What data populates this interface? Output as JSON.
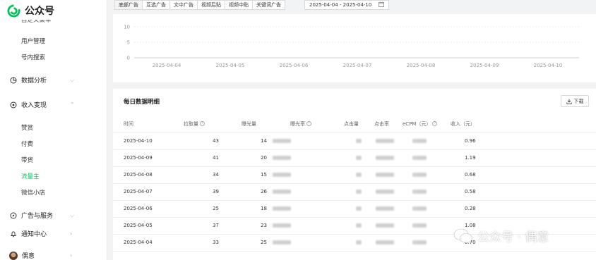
{
  "app": {
    "title": "公众号"
  },
  "sidebar": {
    "cut_item": "自定义菜单",
    "items_top": [
      {
        "label": "用户管理"
      },
      {
        "label": "号内搜索"
      }
    ],
    "groups": {
      "analytics": {
        "label": "数据分析",
        "icon": "chart-icon"
      },
      "monetize": {
        "label": "收入变现",
        "icon": "coin-icon"
      },
      "ads": {
        "label": "广告与服务",
        "icon": "compass-icon"
      },
      "notify": {
        "label": "通知中心",
        "icon": "bell-icon"
      },
      "account": {
        "label": "偶意",
        "icon": "avatar"
      }
    },
    "monetize_items": [
      {
        "label": "赞赏"
      },
      {
        "label": "付费"
      },
      {
        "label": "带货"
      },
      {
        "label": "流量主",
        "active": true
      },
      {
        "label": "微信小店"
      }
    ],
    "accent": "#07c160"
  },
  "filters": {
    "tabs": [
      {
        "label": "底部广告",
        "active": true
      },
      {
        "label": "互选广告"
      },
      {
        "label": "文中广告"
      },
      {
        "label": "视频后贴"
      },
      {
        "label": "视频中贴"
      },
      {
        "label": "关键词广告"
      }
    ],
    "date_range": "2025-04-04 - 2025-04-10"
  },
  "chart_data": {
    "type": "line",
    "x": [
      "2025-04-04",
      "2025-04-05",
      "2025-04-06",
      "2025-04-07",
      "2025-04-08",
      "2025-04-09",
      "2025-04-10"
    ],
    "yticks": [
      "10",
      "5",
      "0"
    ],
    "ylim": [
      0,
      10
    ],
    "grid": true
  },
  "table": {
    "title": "每日数据明细",
    "download_label": "下载",
    "columns": [
      "时间",
      "拉取量",
      "曝光量",
      "曝光率",
      "点击量",
      "点击率",
      "eCPM（元）",
      "收入（元）"
    ],
    "rows": [
      {
        "date": "2025-04-10",
        "pull": "43",
        "exposure": "14",
        "income": "0.96"
      },
      {
        "date": "2025-04-09",
        "pull": "41",
        "exposure": "20",
        "income": "1.19"
      },
      {
        "date": "2025-04-08",
        "pull": "34",
        "exposure": "15",
        "income": "0.68"
      },
      {
        "date": "2025-04-07",
        "pull": "39",
        "exposure": "26",
        "income": "0.58"
      },
      {
        "date": "2025-04-06",
        "pull": "25",
        "exposure": "18",
        "income": "0.28"
      },
      {
        "date": "2025-04-05",
        "pull": "37",
        "exposure": "23",
        "income": "1.08"
      },
      {
        "date": "2025-04-04",
        "pull": "33",
        "exposure": "25",
        "income": "0.70"
      }
    ]
  },
  "watermark": {
    "text": "公众号 · 偶意"
  }
}
